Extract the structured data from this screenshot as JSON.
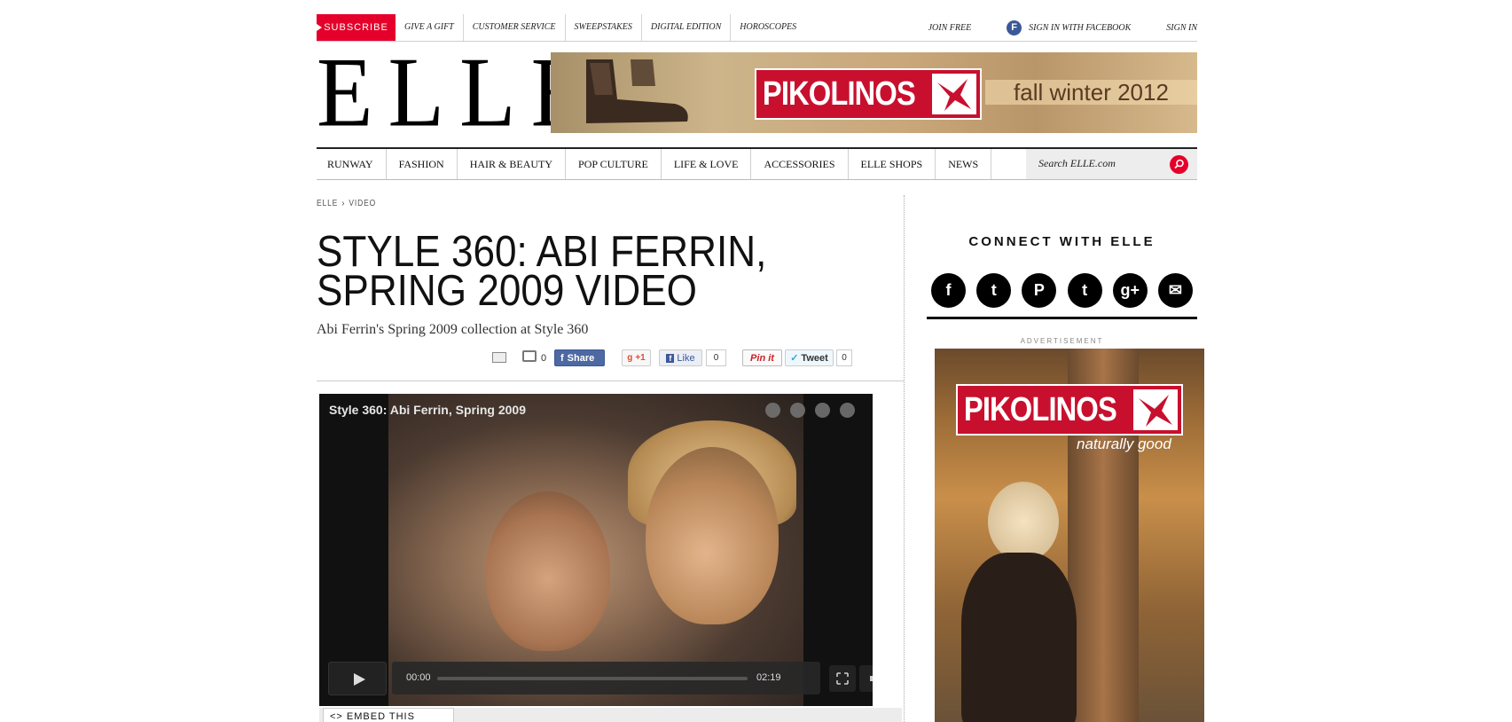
{
  "top_bar": {
    "subscribe": "SUBSCRIBE",
    "links": [
      "GIVE A GIFT",
      "CUSTOMER SERVICE",
      "SWEEPSTAKES",
      "DIGITAL EDITION",
      "HOROSCOPES"
    ],
    "join": "JOIN FREE",
    "facebook": "SIGN IN WITH FACEBOOK",
    "signin": "SIGN IN"
  },
  "logo": "ELLE",
  "banner_ad": {
    "brand": "PIKOLINOS",
    "tagline": "fall winter 2012"
  },
  "nav": {
    "items": [
      "RUNWAY",
      "FASHION",
      "HAIR & BEAUTY",
      "POP CULTURE",
      "LIFE & LOVE",
      "ACCESSORIES",
      "ELLE SHOPS",
      "NEWS"
    ],
    "search_placeholder": "Search ELLE.com"
  },
  "breadcrumb": {
    "home": "ELLE",
    "separator": "›",
    "current": "VIDEO"
  },
  "article": {
    "title": "STYLE 360: ABI FERRIN, SPRING 2009 VIDEO",
    "dek": "Abi Ferrin's Spring 2009 collection at Style 360"
  },
  "share": {
    "comment_count": "0",
    "share_label": "Share",
    "gplus_label": "+1",
    "like_label": "Like",
    "like_count": "0",
    "pin_label": "Pin it",
    "tweet_label": "Tweet",
    "tweet_count": "0"
  },
  "video": {
    "title": "Style 360: Abi Ferrin, Spring 2009",
    "current_time": "00:00",
    "duration": "02:19",
    "progress": 0
  },
  "embed": {
    "label": "<> EMBED THIS VIDEO"
  },
  "sidebar": {
    "connect_title": "CONNECT WITH ELLE",
    "socials": [
      {
        "name": "facebook-icon",
        "glyph": "f"
      },
      {
        "name": "twitter-icon",
        "glyph": "t"
      },
      {
        "name": "pinterest-icon",
        "glyph": "P"
      },
      {
        "name": "tumblr-icon",
        "glyph": "t"
      },
      {
        "name": "google-plus-icon",
        "glyph": "g+"
      },
      {
        "name": "email-icon",
        "glyph": "✉"
      }
    ],
    "ad_label": "ADVERTISEMENT",
    "ad_brand": "PIKOLINOS",
    "ad_tagline": "naturally good"
  },
  "colors": {
    "accent": "#e5002b",
    "pikolinos_red": "#c8102e",
    "facebook": "#3b5998"
  }
}
